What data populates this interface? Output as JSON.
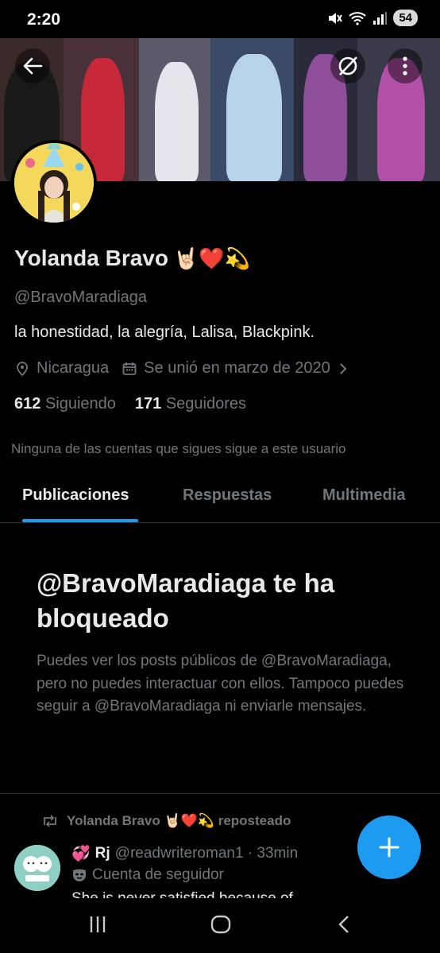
{
  "status": {
    "time": "2:20",
    "battery": "54"
  },
  "profile": {
    "name": "Yolanda Bravo",
    "name_emojis": "🤘🏻❤️💫",
    "handle": "@BravoMaradiaga",
    "bio": "la honestidad, la alegría, Lalisa, Blackpink.",
    "location": "Nicaragua",
    "joined": "Se unió en marzo de 2020",
    "following_count": "612",
    "following_label": "Siguiendo",
    "followers_count": "171",
    "followers_label": "Seguidores",
    "mutual_note": "Ninguna de las cuentas que sigues sigue a este usuario"
  },
  "tabs": [
    {
      "label": "Publicaciones",
      "active": true
    },
    {
      "label": "Respuestas",
      "active": false
    },
    {
      "label": "Multimedia",
      "active": false
    }
  ],
  "blocked": {
    "title": "@BravoMaradiaga te ha bloqueado",
    "description": "Puedes ver los posts públicos de @BravoMaradiaga, pero no puedes interactuar con ellos. Tampoco puedes seguir a @BravoMaradiaga ni enviarle mensajes."
  },
  "post": {
    "repost_by": "Yolanda Bravo 🤘🏻❤️💫 reposteado",
    "author_emoji": "💞",
    "author_name": "Rj",
    "author_handle": "@readwriteroman1 · 33min",
    "account_type": "Cuenta de seguidor",
    "text": "She is never satisfied because of"
  },
  "icons": {
    "back": "back-arrow-icon",
    "grok": "grok-icon",
    "more": "more-vertical-icon",
    "location": "location-pin-icon",
    "calendar": "calendar-icon",
    "chevron": "chevron-right-icon",
    "repost": "repost-icon",
    "follower_account": "mask-icon",
    "compose": "plus-icon"
  },
  "colors": {
    "background": "#000000",
    "accent": "#1d9bf0",
    "text_primary": "#e7e9ea",
    "text_secondary": "#71767b"
  }
}
